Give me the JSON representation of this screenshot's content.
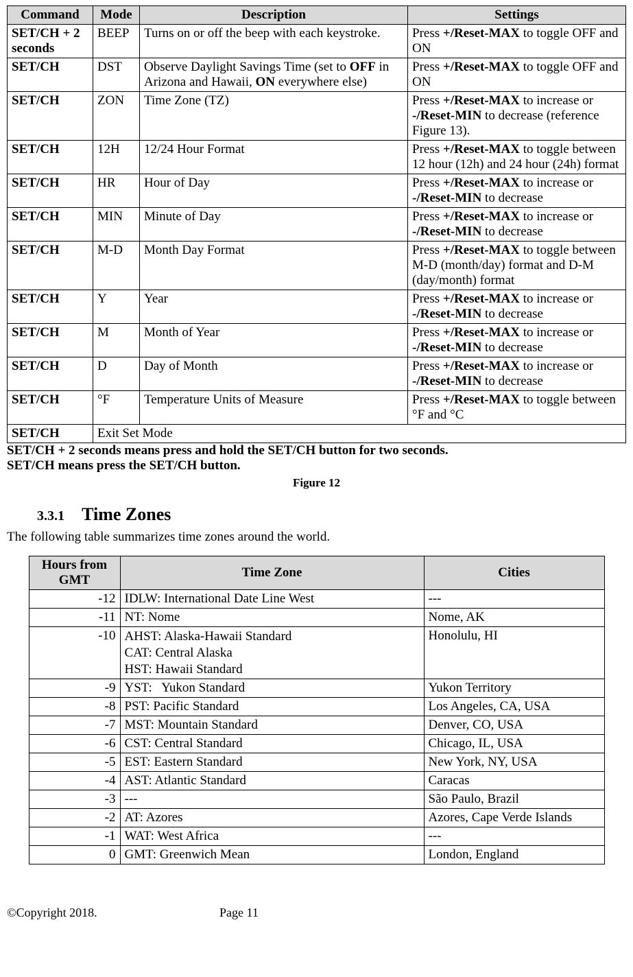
{
  "table1": {
    "headers": [
      "Command",
      "Mode",
      "Description",
      "Settings"
    ],
    "rows": [
      {
        "command_parts": [
          "SET/CH + 2 seconds"
        ],
        "mode": "BEEP",
        "desc_parts": [
          [
            "Turns on or off the beep with each keystroke."
          ]
        ],
        "settings_parts": [
          [
            "Press ",
            "+/Reset-MAX",
            " to toggle OFF and ON"
          ]
        ]
      },
      {
        "command_parts": [
          "SET/CH"
        ],
        "mode": "DST",
        "desc_parts": [
          [
            "Observe Daylight Savings Time (set to ",
            "OFF",
            " in Arizona and Hawaii, ",
            "ON",
            " everywhere else)"
          ]
        ],
        "settings_parts": [
          [
            "Press ",
            "+/Reset-MAX",
            " to toggle OFF and ON"
          ]
        ]
      },
      {
        "command_parts": [
          "SET/CH"
        ],
        "mode": "ZON",
        "desc_parts": [
          [
            "Time Zone (TZ)"
          ]
        ],
        "settings_parts": [
          [
            "Press ",
            "+/Reset-MAX",
            " to increase or ",
            "-/Reset-MIN",
            " to decrease (reference Figure 13)."
          ]
        ]
      },
      {
        "command_parts": [
          "SET/CH"
        ],
        "mode": "12H",
        "desc_parts": [
          [
            "12/24 Hour Format"
          ]
        ],
        "settings_parts": [
          [
            "Press ",
            "+/Reset-MAX",
            " to toggle between 12 hour (12h) and 24 hour (24h) format"
          ]
        ]
      },
      {
        "command_parts": [
          "SET/CH"
        ],
        "mode": "HR",
        "desc_parts": [
          [
            "Hour of Day"
          ]
        ],
        "settings_parts": [
          [
            "Press ",
            "+/Reset-MAX",
            " to increase or ",
            "-/Reset-MIN",
            " to decrease"
          ]
        ]
      },
      {
        "command_parts": [
          "SET/CH"
        ],
        "mode": "MIN",
        "desc_parts": [
          [
            "Minute of Day"
          ]
        ],
        "settings_parts": [
          [
            "Press ",
            "+/Reset-MAX",
            " to increase or ",
            "-/Reset-MIN",
            " to decrease"
          ]
        ]
      },
      {
        "command_parts": [
          "SET/CH"
        ],
        "mode": "M-D",
        "desc_parts": [
          [
            "Month Day Format"
          ]
        ],
        "settings_parts": [
          [
            "Press ",
            "+/Reset-MAX",
            " to toggle between M-D (month/day) format and D-M (day/month) format"
          ]
        ]
      },
      {
        "command_parts": [
          "SET/CH"
        ],
        "mode": "Y",
        "desc_parts": [
          [
            "Year"
          ]
        ],
        "settings_parts": [
          [
            "Press ",
            "+/Reset-MAX",
            " to increase or ",
            "-/Reset-MIN",
            " to decrease"
          ]
        ]
      },
      {
        "command_parts": [
          "SET/CH"
        ],
        "mode": "M",
        "desc_parts": [
          [
            "Month of Year"
          ]
        ],
        "settings_parts": [
          [
            "Press ",
            "+/Reset-MAX",
            " to increase or ",
            "-/Reset-MIN",
            " to decrease"
          ]
        ]
      },
      {
        "command_parts": [
          "SET/CH"
        ],
        "mode": "D",
        "desc_parts": [
          [
            "Day of Month"
          ]
        ],
        "settings_parts": [
          [
            "Press ",
            "+/Reset-MAX",
            " to increase or ",
            "-/Reset-MIN",
            " to decrease"
          ]
        ]
      },
      {
        "command_parts": [
          "SET/CH"
        ],
        "mode": "°F",
        "desc_parts": [
          [
            "Temperature Units of Measure"
          ]
        ],
        "settings_parts": [
          [
            "Press ",
            "+/Reset-MAX",
            " to toggle between °F and °C"
          ]
        ]
      }
    ],
    "exit_row": {
      "command": "SET/CH",
      "text": "Exit Set Mode"
    }
  },
  "notes": {
    "line1_parts": [
      "SET/CH + 2 seconds means press and hold the SET/CH button for two seconds."
    ],
    "line2_parts": [
      "SET/CH means press the SET/CH button."
    ]
  },
  "figure_caption": "Figure 12",
  "section": {
    "num": "3.3.1",
    "title": "Time Zones"
  },
  "intro": "The following table summarizes time zones around the world.",
  "table2": {
    "headers": [
      "Hours from GMT",
      "Time Zone",
      "Cities"
    ],
    "rows": [
      {
        "h": "-12",
        "tz": [
          "IDLW: International Date Line West"
        ],
        "c": "---"
      },
      {
        "h": "-11",
        "tz": [
          "NT: Nome"
        ],
        "c": "Nome, AK"
      },
      {
        "h": "-10",
        "tz": [
          "AHST: Alaska-Hawaii Standard",
          "CAT: Central Alaska",
          "HST: Hawaii Standard"
        ],
        "c": "Honolulu, HI"
      },
      {
        "h": "-9",
        "tz": [
          "YST:   Yukon Standard"
        ],
        "c": "Yukon Territory"
      },
      {
        "h": "-8",
        "tz": [
          "PST: Pacific Standard"
        ],
        "c": "Los Angeles, CA, USA"
      },
      {
        "h": "-7",
        "tz": [
          "MST: Mountain Standard"
        ],
        "c": "Denver, CO, USA"
      },
      {
        "h": "-6",
        "tz": [
          "CST: Central Standard"
        ],
        "c": "Chicago, IL, USA"
      },
      {
        "h": "-5",
        "tz": [
          "EST: Eastern Standard"
        ],
        "c": "New York, NY, USA"
      },
      {
        "h": "-4",
        "tz": [
          "AST: Atlantic Standard"
        ],
        "c": "Caracas"
      },
      {
        "h": "-3",
        "tz": [
          "---"
        ],
        "c": "São Paulo, Brazil"
      },
      {
        "h": "-2",
        "tz": [
          "AT: Azores"
        ],
        "c": "Azores, Cape Verde Islands"
      },
      {
        "h": "-1",
        "tz": [
          "WAT: West Africa"
        ],
        "c": "---"
      },
      {
        "h": "0",
        "tz": [
          "GMT: Greenwich Mean"
        ],
        "c": "London, England"
      }
    ]
  },
  "footer": {
    "copyright": "©Copyright 2018.",
    "page": "Page 11"
  }
}
